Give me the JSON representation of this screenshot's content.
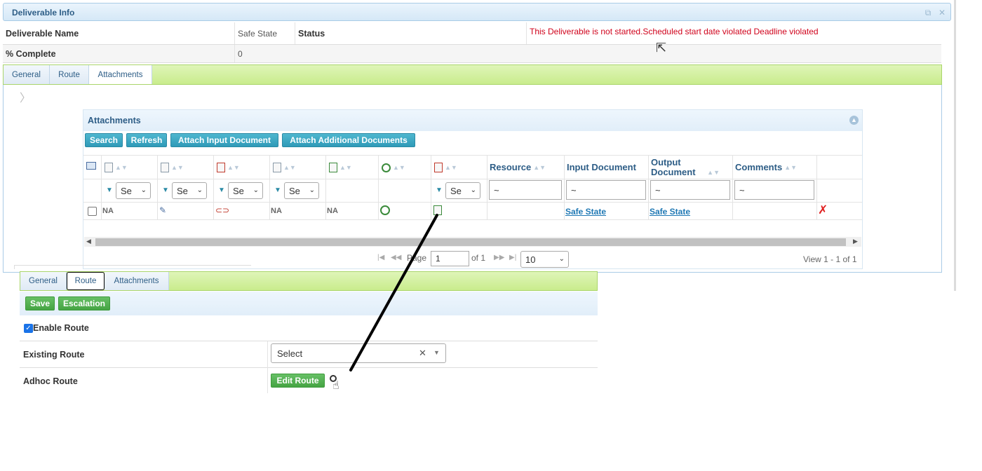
{
  "panel": {
    "title": "Deliverable Info",
    "popout_icon": "popout-icon",
    "close_icon": "close-icon"
  },
  "info": {
    "name_label": "Deliverable Name",
    "name_value": "Safe State",
    "status_label": "Status",
    "status_value": "This Deliverable is not started.Scheduled start date violated Deadline violated",
    "complete_label": "% Complete",
    "complete_value": "0"
  },
  "tabs": [
    {
      "label": "General"
    },
    {
      "label": "Route"
    },
    {
      "label": "Attachments"
    }
  ],
  "active_tab": "Attachments",
  "attachments": {
    "title": "Attachments",
    "buttons": {
      "search": "Search",
      "refresh": "Refresh",
      "attach_input": "Attach Input Document",
      "attach_additional": "Attach Additional Documents"
    },
    "columns": {
      "resource": "Resource",
      "input_document": "Input Document",
      "output_document": "Output Document",
      "comments": "Comments"
    },
    "filter_select_value": "Se",
    "filter_text_value": "~",
    "row": {
      "col1": "NA",
      "col4": "NA",
      "col5": "NA",
      "input_document": "Safe State",
      "output_document": "Safe State"
    },
    "pager": {
      "page_label": "Page",
      "page_value": "1",
      "of_label": "of 1",
      "page_size": "10",
      "view_text": "View 1 - 1 of 1"
    }
  },
  "route": {
    "tabs": [
      {
        "label": "General"
      },
      {
        "label": "Route"
      },
      {
        "label": "Attachments"
      }
    ],
    "active_tab": "Route",
    "buttons": {
      "save": "Save",
      "escalation": "Escalation",
      "edit_route": "Edit Route"
    },
    "enable_route_label": "Enable Route",
    "enable_route_checked": true,
    "existing_route_label": "Existing Route",
    "existing_route_value": "Select",
    "adhoc_route_label": "Adhoc Route"
  },
  "colors": {
    "tab_bar": "#c9ec8d",
    "header_blue": "#2d5d86",
    "button_blue": "#2f9ab8",
    "button_green": "#45a443",
    "error_red": "#d0021b",
    "link_blue": "#1f78b4"
  }
}
